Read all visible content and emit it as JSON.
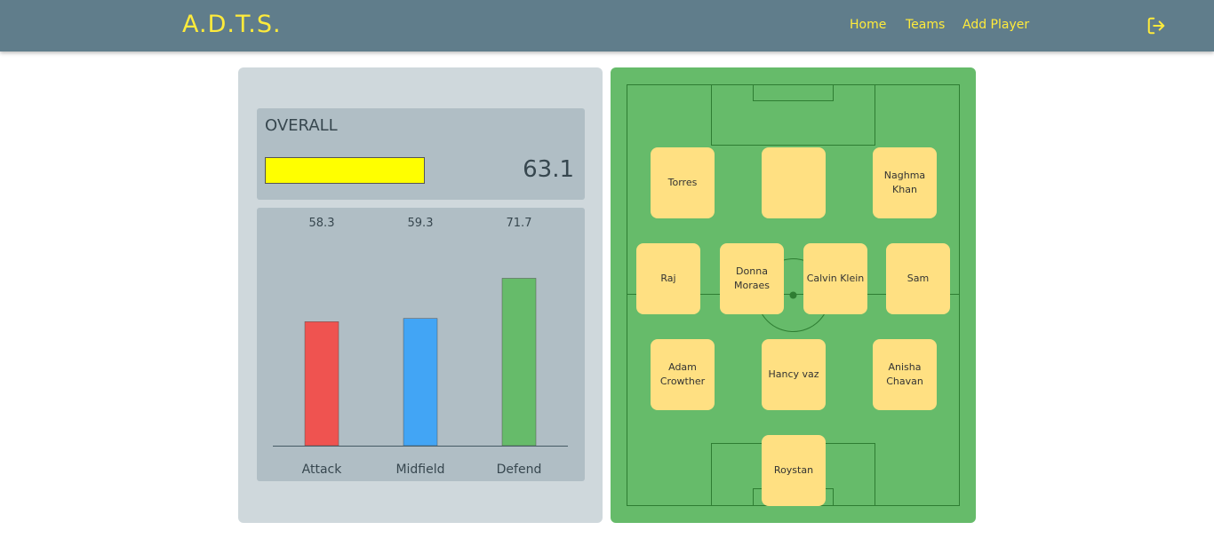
{
  "header": {
    "brand": "A.D.T.S.",
    "nav": [
      {
        "label": "Home"
      },
      {
        "label": "Teams"
      },
      {
        "label": "Add Player"
      }
    ],
    "logout_icon": "logout-icon",
    "accent_color": "#ffeb3b",
    "bar_color": "#607d8b"
  },
  "overall": {
    "title": "OVERALL",
    "value": "63.1",
    "fill_color": "#ffff00"
  },
  "chart_data": {
    "type": "bar",
    "categories": [
      "Attack",
      "Midfield",
      "Defend"
    ],
    "values": [
      58.3,
      59.3,
      71.7
    ],
    "value_labels": [
      "58.3",
      "59.3",
      "71.7"
    ],
    "colors": [
      "#ef5350",
      "#42a5f5",
      "#66bb6a"
    ],
    "ylim": [
      0,
      100
    ],
    "title": "",
    "xlabel": "",
    "ylabel": ""
  },
  "pitch": {
    "color": "#66bb6a",
    "card_color": "#ffe082",
    "players": [
      {
        "name": "Torres",
        "row": 0,
        "col": 0
      },
      {
        "name": "",
        "row": 0,
        "col": 1
      },
      {
        "name": "Naghma Khan",
        "row": 0,
        "col": 2
      },
      {
        "name": "Raj",
        "row": 1,
        "col": 0
      },
      {
        "name": "Donna Moraes",
        "row": 1,
        "col": 1
      },
      {
        "name": "Calvin Klein",
        "row": 1,
        "col": 2
      },
      {
        "name": "Sam",
        "row": 1,
        "col": 3
      },
      {
        "name": "Adam Crowther",
        "row": 2,
        "col": 0
      },
      {
        "name": "Hancy vaz",
        "row": 2,
        "col": 1
      },
      {
        "name": "Anisha Chavan",
        "row": 2,
        "col": 2
      },
      {
        "name": "Roystan",
        "row": 3,
        "col": 0
      }
    ]
  }
}
